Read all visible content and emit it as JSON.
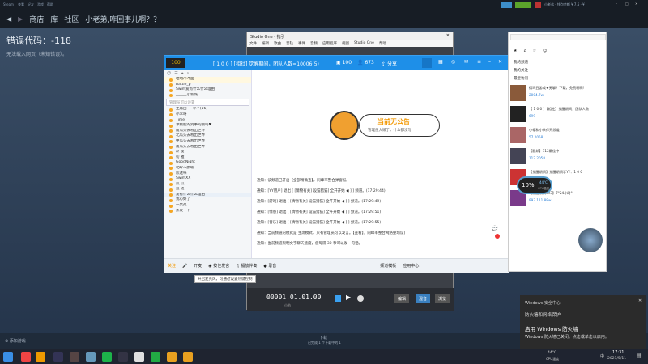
{
  "steam": {
    "titlebar": [
      "Steam",
      "查看",
      "好友",
      "游戏",
      "帮助"
    ],
    "nav_back": "◀",
    "nav_fwd": "▶",
    "nav_items": [
      "商店",
      "库",
      "社区"
    ],
    "nav_title": "小老弟,咋回事儿啊？？",
    "user_label": "小老弟 · 钱包余额 ¥ 7.5 · ¥",
    "error_code": "错误代码：-118",
    "error_desc": "无法载入网页（未知错误）。",
    "add_game": "添加游戏",
    "downloads": "下载",
    "downloads_sub": "已完成 1 个下载中的 1",
    "friends": "好友与聊天"
  },
  "studio_one": {
    "title": "Studio One - 指引",
    "menu": [
      "文件",
      "编辑",
      "歌曲",
      "音轨",
      "事件",
      "音频",
      "应用程序",
      "视图",
      "Studio One",
      "帮助"
    ],
    "time_display": "00001.01.01.00",
    "time_sub": "小节",
    "tab_edit": "编辑",
    "tab_mix": "混音",
    "tab_browse": "浏览"
  },
  "yy": {
    "header_title": "[ 1 0 0 ] [相社] 觉醒期间，团队人数=10006(5)",
    "header_count": "100",
    "header_people": "673",
    "header_share": "分享",
    "tree_title": "唯唱冷冲面",
    "tree_search_placeholder": "管理员可以设置",
    "tree_rows": [
      "Battle_p",
      "Swim爱有什么什么理由",
      "______小新城",
      "主席团 — 小丫(16)",
      "小李呀",
      "Time",
      "承接能的到事的刚吗♥",
      "南瓜头去啦出世界",
      "北瓜头去啦出世界",
      "中瓜头去啦出世界",
      "南瓜头去啦出世界",
      "冷 俊",
      "初 雅",
      "GoodNight",
      "北岭人鹏瑜",
      "影迷咪",
      "SwimXX",
      "瓜 瓜",
      "追 随",
      "爱有什么什么理由",
      "我心好了",
      "一桌苑",
      "蒸发一下"
    ],
    "notice_title": "当前无公告",
    "notice_sub": "管理员大懒了，什么都没写",
    "chat_lines": [
      "通知：该频道已开启【全部精确查】，同峰率整合弹窗报。",
      "通知：[YY用户] 退出 [ [情物有关] 设猫猎猫] 全开开始 ◀ ] ] 频道。(17:29:44)",
      "通知：[游戏] 退出 [ [情物有关] 设猫猎猫] 全开开始 ◀ ] ] 频道。(17:29:49)",
      "通知：[情感] 退出 [ [情物有关] 设猫猎猫] 全开开始 ◀ ] ] 频道。(17:29:51)",
      "通知：[音乐] 退出 [ [情物有关] 设猫猎猫] 全开开始 ◀ ] ] 频道。(17:29:55)",
      "通知：当前频道的模式是 主席模式，只有管理员可以发言。【查看】，同峰率整合网络整场设]",
      "通知：当前频道限制文字聊天速度，您每隔 30 秒可以发一句话。"
    ],
    "bottom_items": [
      "关注",
      "开麦",
      "按住发言",
      "播放伴奏",
      "录音"
    ],
    "bottom_right": [
      "频道模板",
      "应用中心"
    ],
    "tooltip": "开启麦克风，可通过设置热键控制"
  },
  "right_panel": {
    "sections": [
      "我的频道",
      "我的关注",
      "最近访问"
    ],
    "items": [
      {
        "t1": "德玛丑游戏★无聊？下载，免费啊啊!",
        "t2": "2004.7w"
      },
      {
        "t1": "【 1 0 0 】【相社】觉醒期间，团队人数",
        "t2": "699"
      },
      {
        "t1": "小帽和小伙伴开频道",
        "t2": "57   2058"
      },
      {
        "t1": "【影邦】112最佳中",
        "t2": "112  2058"
      },
      {
        "t1": "【觉醒期间】觉醒期间学YY：1 0 0",
        "t2": "1008  6395"
      },
      {
        "t1": "【觉醒期间993】7°24小时°",
        "t2": "993  111.88w"
      }
    ]
  },
  "widget": {
    "percent": "10%",
    "temp": "44°C",
    "label": "CPU温度"
  },
  "toast": {
    "header": "Windows 安全中心",
    "sub": "防火墙和网络保护",
    "title": "启用 Windows 防火墙",
    "desc": "Windows 防火墙已关闭。点击或单击以启用。"
  },
  "taskbar": {
    "temp": "44°C",
    "temp_label": "CPU温度",
    "time": "17:31",
    "date": "2021/5/11",
    "lang": "中"
  }
}
